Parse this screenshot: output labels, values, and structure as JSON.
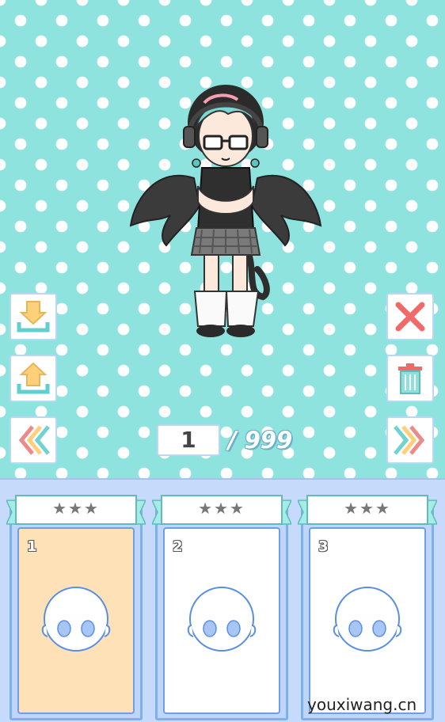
{
  "counter": {
    "current": "1",
    "total": "/ 999"
  },
  "slots": [
    {
      "stars": "★★★",
      "number": "1",
      "selected": true
    },
    {
      "stars": "★★★",
      "number": "2",
      "selected": false
    },
    {
      "stars": "★★★",
      "number": "3",
      "selected": false
    }
  ],
  "buttons": {
    "left": [
      "save-icon",
      "load-icon",
      "previous-icon"
    ],
    "right": [
      "close-icon",
      "trash-icon",
      "next-icon"
    ]
  },
  "watermark": "youxiwang.cn",
  "colors": {
    "stage_bg": "#8fe3df",
    "tray_bg": "#c6dafb",
    "selected_card": "#ffe1b8",
    "accent_red": "#f06a6a"
  }
}
